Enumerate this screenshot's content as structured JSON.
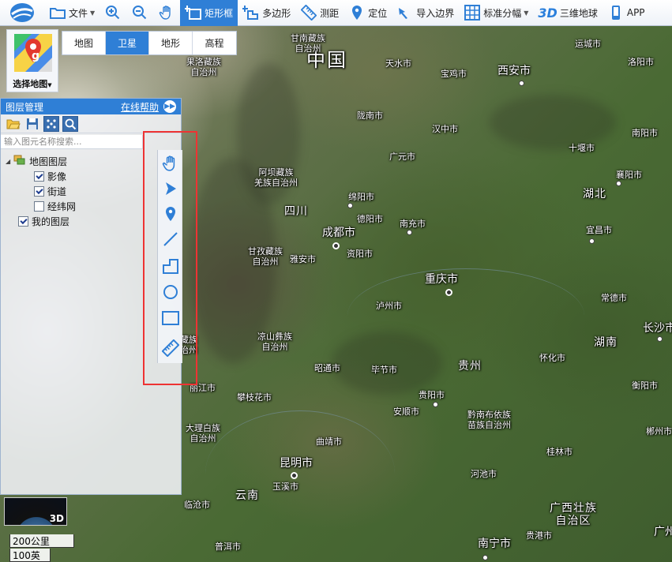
{
  "toolbar": {
    "file": "文件",
    "rect": "矩形框",
    "polygon": "多边形",
    "measure": "测距",
    "locate": "定位",
    "import_border": "导入边界",
    "standard_sheet": "标准分幅",
    "globe_3d_prefix": "3D",
    "globe_3d": "三维地球",
    "app": "APP"
  },
  "map_selector": {
    "label": "选择地图"
  },
  "map_types": [
    {
      "label": "地图",
      "active": false
    },
    {
      "label": "卫星",
      "active": true
    },
    {
      "label": "地形",
      "active": false
    },
    {
      "label": "高程",
      "active": false
    }
  ],
  "layer_panel": {
    "title": "图层管理",
    "help": "在线帮助",
    "search_placeholder": "输入图元名称搜索...",
    "tree": {
      "root": "地图图层",
      "children": [
        {
          "label": "影像",
          "checked": true
        },
        {
          "label": "街道",
          "checked": true
        },
        {
          "label": "经纬网",
          "checked": false
        }
      ],
      "mine": {
        "label": "我的图层",
        "checked": true
      }
    }
  },
  "minimap": {
    "label": "3D"
  },
  "scale": {
    "km": "200公里",
    "mi": "100英里"
  },
  "labels": {
    "country": "中国",
    "gannan": "甘南藏族\n自治州",
    "guoluo": "果洛藏族\n自治州",
    "tianshui": "天水市",
    "baoji": "宝鸡市",
    "xian": "西安市",
    "yuncheng": "运城市",
    "luoyang": "洛阳市",
    "longnan": "陇南市",
    "hanzhong": "汉中市",
    "nanyang": "南阳市",
    "shiyan": "十堰市",
    "guangyuan": "广元市",
    "aba": "阿坝藏族\n羌族自治州",
    "xiangyang": "襄阳市",
    "hubei": "湖北",
    "mianyang": "绵阳市",
    "sichuan": "四川",
    "deyang": "德阳市",
    "nanchong": "南充市",
    "chengdu": "成都市",
    "yichang": "宜昌市",
    "ganzi": "甘孜藏族\n自治州",
    "yaan": "雅安市",
    "ziyang": "资阳市",
    "chongqing": "重庆市",
    "luzhou": "泸州市",
    "changde": "常德市",
    "changsha": "长沙市",
    "liangshan": "凉山彝族\n自治州",
    "hunan": "湖南",
    "zhaotong": "昭通市",
    "bijie": "毕节市",
    "guizhou": "贵州",
    "huaihua": "怀化市",
    "hengyang": "衡阳市",
    "lijiang": "丽江市",
    "panzhihua": "攀枝花市",
    "guiyang": "贵阳市",
    "anshun": "安顺市",
    "qiannan": "黔南布依族\n苗族自治州",
    "chenzhou": "郴州市",
    "dali": "大理白族\n自治州",
    "qujing": "曲靖市",
    "guilin": "桂林市",
    "kunming": "昆明市",
    "hechi": "河池市",
    "yuxi": "玉溪市",
    "yunnan": "云南",
    "guangxi": "广西壮族\n自治区",
    "lincang": "临沧市",
    "guigang": "贵港市",
    "guangzhou": "广州",
    "puer": "普洱市",
    "nanning": "南宁市",
    "xizang_partial": "藏族\n治州"
  }
}
